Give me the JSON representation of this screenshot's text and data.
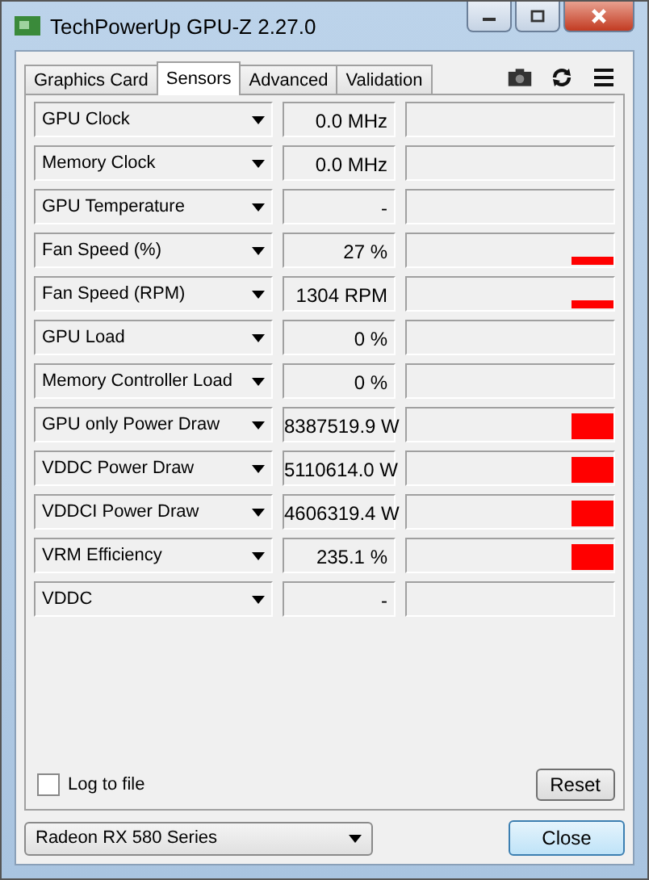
{
  "window": {
    "title": "TechPowerUp GPU-Z 2.27.0"
  },
  "tabs": [
    {
      "label": "Graphics Card",
      "selected": false
    },
    {
      "label": "Sensors",
      "selected": true
    },
    {
      "label": "Advanced",
      "selected": false
    },
    {
      "label": "Validation",
      "selected": false
    }
  ],
  "sensors": [
    {
      "kind": "idle",
      "name": "GPU Clock",
      "value": "0.0 MHz"
    },
    {
      "kind": "idle",
      "name": "Memory Clock",
      "value": "0.0 MHz"
    },
    {
      "kind": "idle",
      "name": "GPU Temperature",
      "value": "-"
    },
    {
      "kind": "low",
      "name": "Fan Speed (%)",
      "value": "27 %"
    },
    {
      "kind": "low",
      "name": "Fan Speed (RPM)",
      "value": "1304 RPM"
    },
    {
      "kind": "idle",
      "name": "GPU Load",
      "value": "0 %"
    },
    {
      "kind": "idle",
      "name": "Memory Controller Load",
      "value": "0 %"
    },
    {
      "kind": "high",
      "name": "GPU only Power Draw",
      "value": "8387519.9 W"
    },
    {
      "kind": "high",
      "name": "VDDC Power Draw",
      "value": "5110614.0 W"
    },
    {
      "kind": "high",
      "name": "VDDCI Power Draw",
      "value": "4606319.4 W"
    },
    {
      "kind": "high",
      "name": "VRM Efficiency",
      "value": "235.1 %"
    },
    {
      "kind": "idle",
      "name": "VDDC",
      "value": "-"
    }
  ],
  "log_to_file": {
    "label": "Log to file",
    "checked": false
  },
  "reset_button": "Reset",
  "gpu_select": {
    "value": "Radeon RX 580 Series"
  },
  "close_button": "Close"
}
